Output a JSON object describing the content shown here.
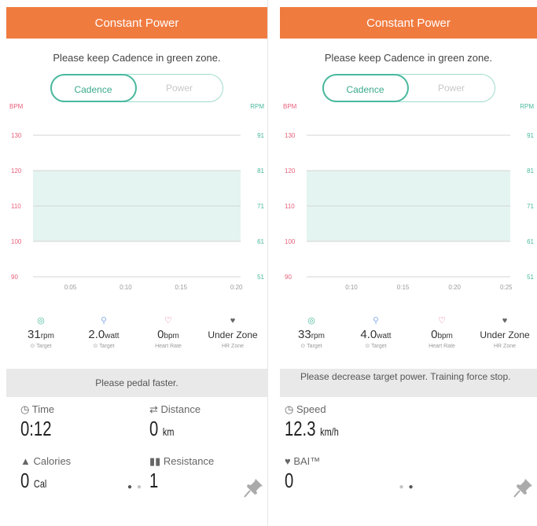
{
  "colors": {
    "header": "#f07b3f",
    "zone": "#e4f4f1",
    "cadence": "#49b99d",
    "power": "#8fb0e8",
    "heart": "#e8627c",
    "muted": "#9a9a9a"
  },
  "left": {
    "header": "Constant Power",
    "instruction": "Please keep Cadence in green zone.",
    "toggle": {
      "active": "Cadence",
      "inactive": "Power"
    },
    "chart_data": {
      "type": "line",
      "left_axis_label": "BPM",
      "right_axis_label": "RPM",
      "left_ticks": [
        "130",
        "120",
        "110",
        "100",
        "90"
      ],
      "right_ticks": [
        "91",
        "81",
        "71",
        "61",
        "51"
      ],
      "x_ticks": [
        "0:05",
        "0:10",
        "0:15",
        "0:20"
      ],
      "green_zone_rpm": [
        61,
        81
      ],
      "series": []
    },
    "stats": [
      {
        "icon": "target-icon",
        "value": "31",
        "unit": "rpm",
        "label": "⊙ Target"
      },
      {
        "icon": "pin-icon",
        "value": "2.0",
        "unit": "watt",
        "label": "⊙ Target"
      },
      {
        "icon": "heart-icon",
        "value": "0",
        "unit": "bpm",
        "label": "Heart Rate"
      },
      {
        "icon": "heart-zone-icon",
        "value": "Under Zone",
        "unit": "",
        "label": "HR Zone"
      }
    ],
    "message": "Please pedal faster.",
    "metrics": [
      {
        "icon": "clock-icon",
        "label": "Time",
        "value": "0:12",
        "unit": ""
      },
      {
        "icon": "distance-icon",
        "label": "Distance",
        "value": "0",
        "unit": "km"
      },
      {
        "icon": "flame-icon",
        "label": "Calories",
        "value": "0",
        "unit": "Cal"
      },
      {
        "icon": "resistance-icon",
        "label": "Resistance",
        "value": "1",
        "unit": ""
      }
    ],
    "page_index": 1,
    "page_count": 2
  },
  "right": {
    "header": "Constant Power",
    "instruction": "Please keep Cadence in green zone.",
    "toggle": {
      "active": "Cadence",
      "inactive": "Power"
    },
    "chart_data": {
      "type": "line",
      "left_axis_label": "BPM",
      "right_axis_label": "RPM",
      "left_ticks": [
        "130",
        "120",
        "110",
        "100",
        "90"
      ],
      "right_ticks": [
        "91",
        "81",
        "71",
        "61",
        "51"
      ],
      "x_ticks": [
        "0:10",
        "0:15",
        "0:20",
        "0:25"
      ],
      "green_zone_rpm": [
        61,
        81
      ],
      "series": []
    },
    "stats": [
      {
        "icon": "target-icon",
        "value": "33",
        "unit": "rpm",
        "label": "⊙ Target"
      },
      {
        "icon": "pin-icon",
        "value": "4.0",
        "unit": "watt",
        "label": "⊙ Target"
      },
      {
        "icon": "heart-icon",
        "value": "0",
        "unit": "bpm",
        "label": "Heart Rate"
      },
      {
        "icon": "heart-zone-icon",
        "value": "Under Zone",
        "unit": "",
        "label": "HR Zone"
      }
    ],
    "message": "Please decrease target power. Training force stop.",
    "metrics": [
      {
        "icon": "speedometer-icon",
        "label": "Speed",
        "value": "12.3",
        "unit": "km/h"
      },
      {
        "icon": "bai-icon",
        "label": "BAI™",
        "value": "0",
        "unit": ""
      }
    ],
    "page_index": 2,
    "page_count": 2
  }
}
